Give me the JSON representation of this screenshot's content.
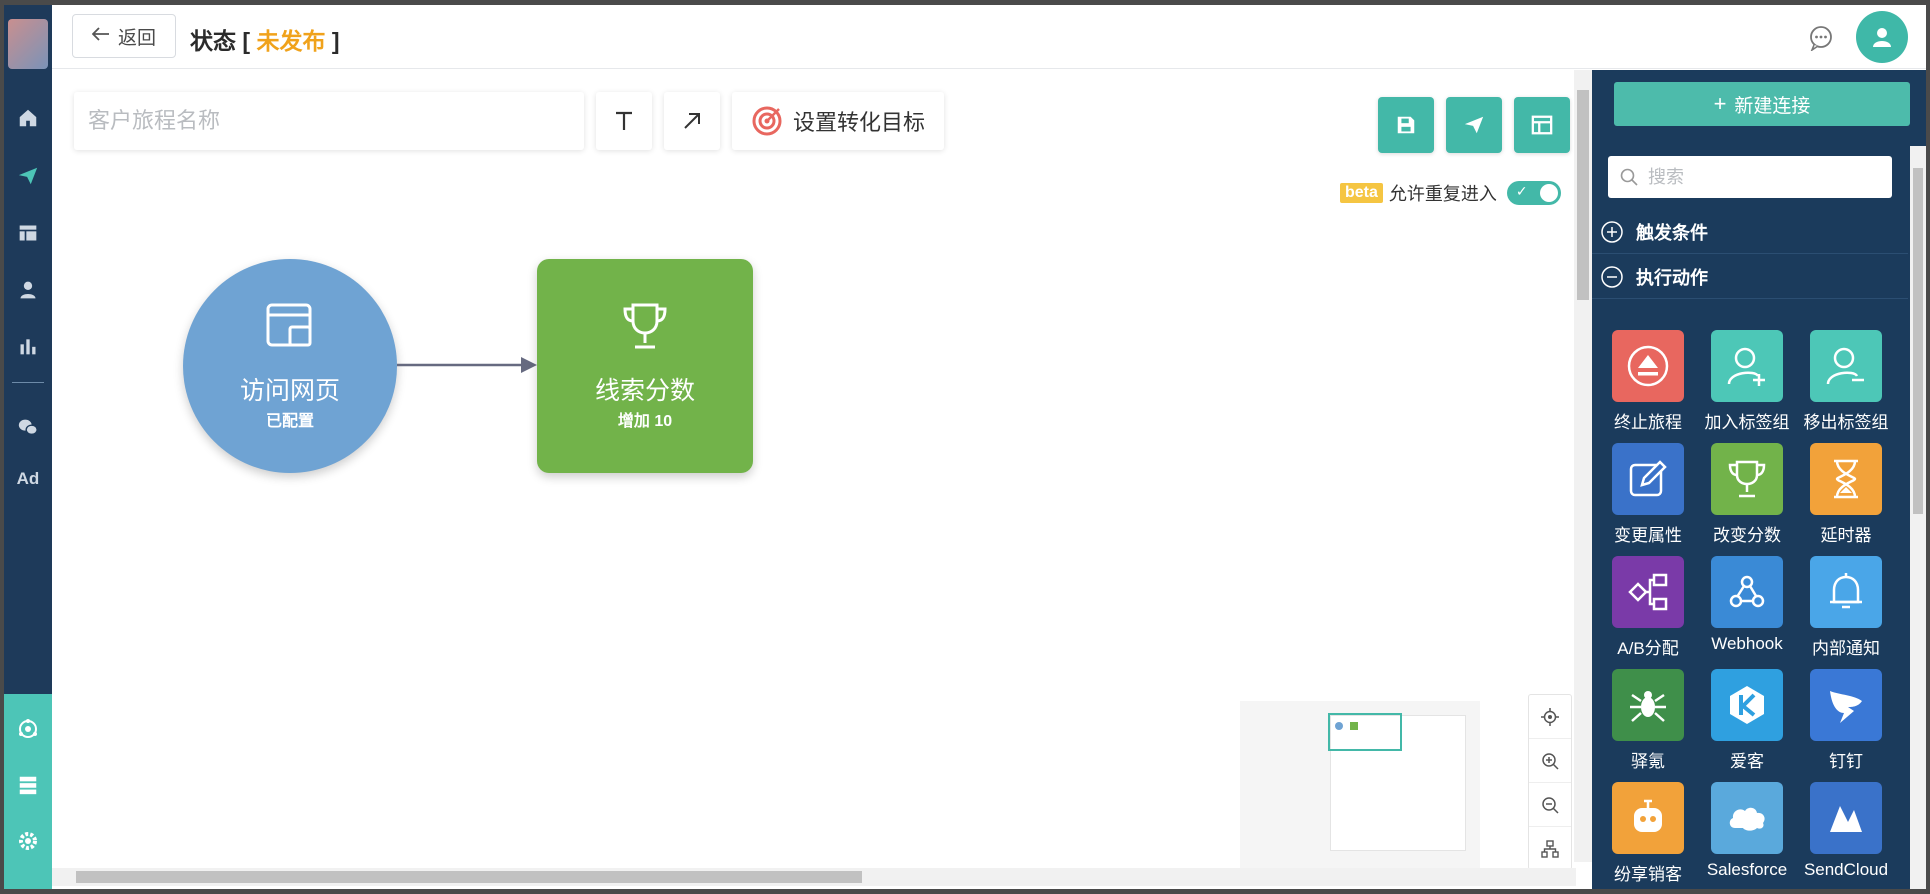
{
  "topbar": {
    "back_label": "返回",
    "status_prefix": "状态 [ ",
    "status_value": "未发布",
    "status_suffix": " ]"
  },
  "leftnav": {
    "ad_label": "Ad"
  },
  "canvas": {
    "name_placeholder": "客户旅程名称",
    "goal_label": "设置转化目标",
    "beta_badge": "beta",
    "repeat_label": "允许重复进入",
    "repeat_enabled": true,
    "nodes": [
      {
        "title": "访问网页",
        "subtitle": "已配置",
        "color": "#6fa3d3"
      },
      {
        "title": "线索分数",
        "subtitle": "增加 10",
        "color": "#72b34a"
      }
    ]
  },
  "panel": {
    "new_connection_label": "新建连接",
    "search_placeholder": "搜索",
    "sections": [
      {
        "label": "触发条件",
        "expanded": false
      },
      {
        "label": "执行动作",
        "expanded": true
      }
    ],
    "actions": [
      {
        "label": "终止旅程",
        "icon": "eject-icon",
        "color": "#e8675f"
      },
      {
        "label": "加入标签组",
        "icon": "user-plus-icon",
        "color": "#4dc7b7"
      },
      {
        "label": "移出标签组",
        "icon": "user-minus-icon",
        "color": "#4dc7b7"
      },
      {
        "label": "变更属性",
        "icon": "edit-icon",
        "color": "#3a72c9"
      },
      {
        "label": "改变分数",
        "icon": "trophy-icon",
        "color": "#72b34a"
      },
      {
        "label": "延时器",
        "icon": "hourglass-icon",
        "color": "#f2a23a"
      },
      {
        "label": "A/B分配",
        "icon": "split-icon",
        "color": "#7a3aa8"
      },
      {
        "label": "Webhook",
        "icon": "webhook-icon",
        "color": "#3a8ad6"
      },
      {
        "label": "内部通知",
        "icon": "bell-icon",
        "color": "#4aa6e8"
      },
      {
        "label": "驿氪",
        "icon": "spider-icon",
        "color": "#3f8f4a"
      },
      {
        "label": "爱客",
        "icon": "k-icon",
        "color": "#2fa0e0"
      },
      {
        "label": "钉钉",
        "icon": "dingtalk-icon",
        "color": "#3a78d6"
      },
      {
        "label": "纷享销客",
        "icon": "robot-icon",
        "color": "#f2a23a"
      },
      {
        "label": "Salesforce",
        "icon": "cloud-icon",
        "color": "#5aa9dc"
      },
      {
        "label": "SendCloud",
        "icon": "sendcloud-icon",
        "color": "#3a72c9"
      }
    ]
  }
}
